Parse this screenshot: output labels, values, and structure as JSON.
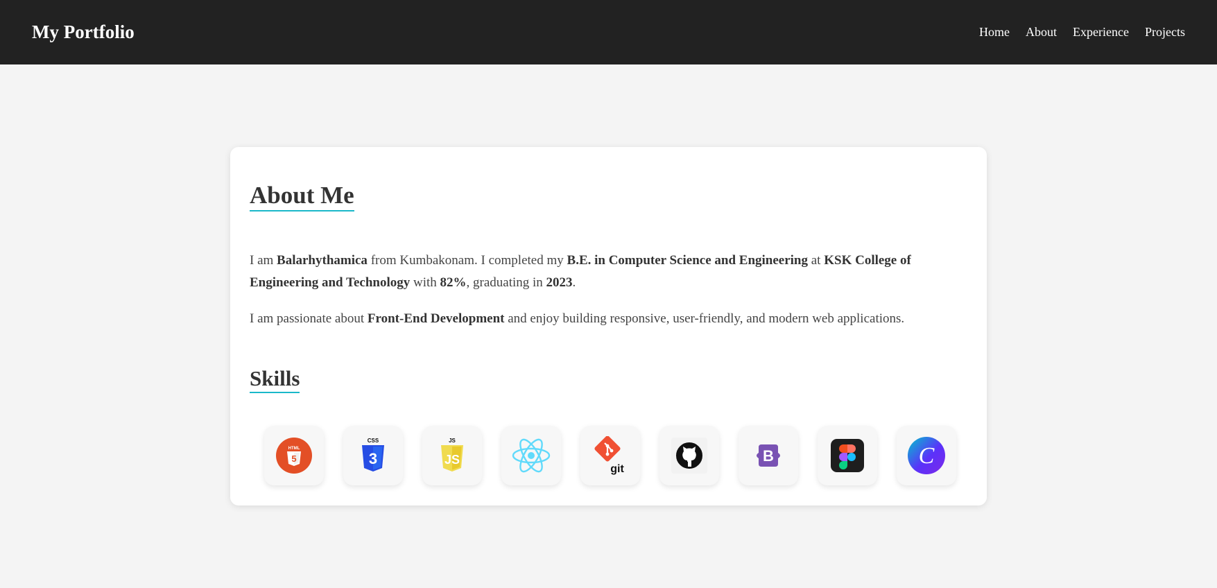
{
  "nav": {
    "brand": "My Portfolio",
    "links": [
      "Home",
      "About",
      "Experience",
      "Projects"
    ]
  },
  "about": {
    "title": "About Me",
    "p1": {
      "t1": "I am ",
      "name": "Balarhythamica",
      "t2": " from Kumbakonam. I completed my ",
      "degree": "B.E. in Computer Science and Engineering",
      "t3": " at ",
      "college": "KSK College of Engineering and Technology",
      "t4": " with ",
      "score": "82%",
      "t5": ", graduating in ",
      "year": "2023",
      "t6": "."
    },
    "p2": {
      "t1": "I am passionate about ",
      "focus": "Front-End Development",
      "t2": " and enjoy building responsive, user-friendly, and modern web applications."
    }
  },
  "skills": {
    "title": "Skills",
    "icons": [
      "html5-icon",
      "css3-icon",
      "javascript-icon",
      "react-icon",
      "git-icon",
      "github-icon",
      "bootstrap-icon",
      "figma-icon",
      "canva-icon"
    ],
    "icon_text": {
      "html": "HTML",
      "css": "CSS",
      "js": "JS",
      "git": "git",
      "bootstrap": "B"
    }
  },
  "colors": {
    "navbar": "#222222",
    "accent": "#1ab8c9",
    "background": "#f4f4f4"
  }
}
